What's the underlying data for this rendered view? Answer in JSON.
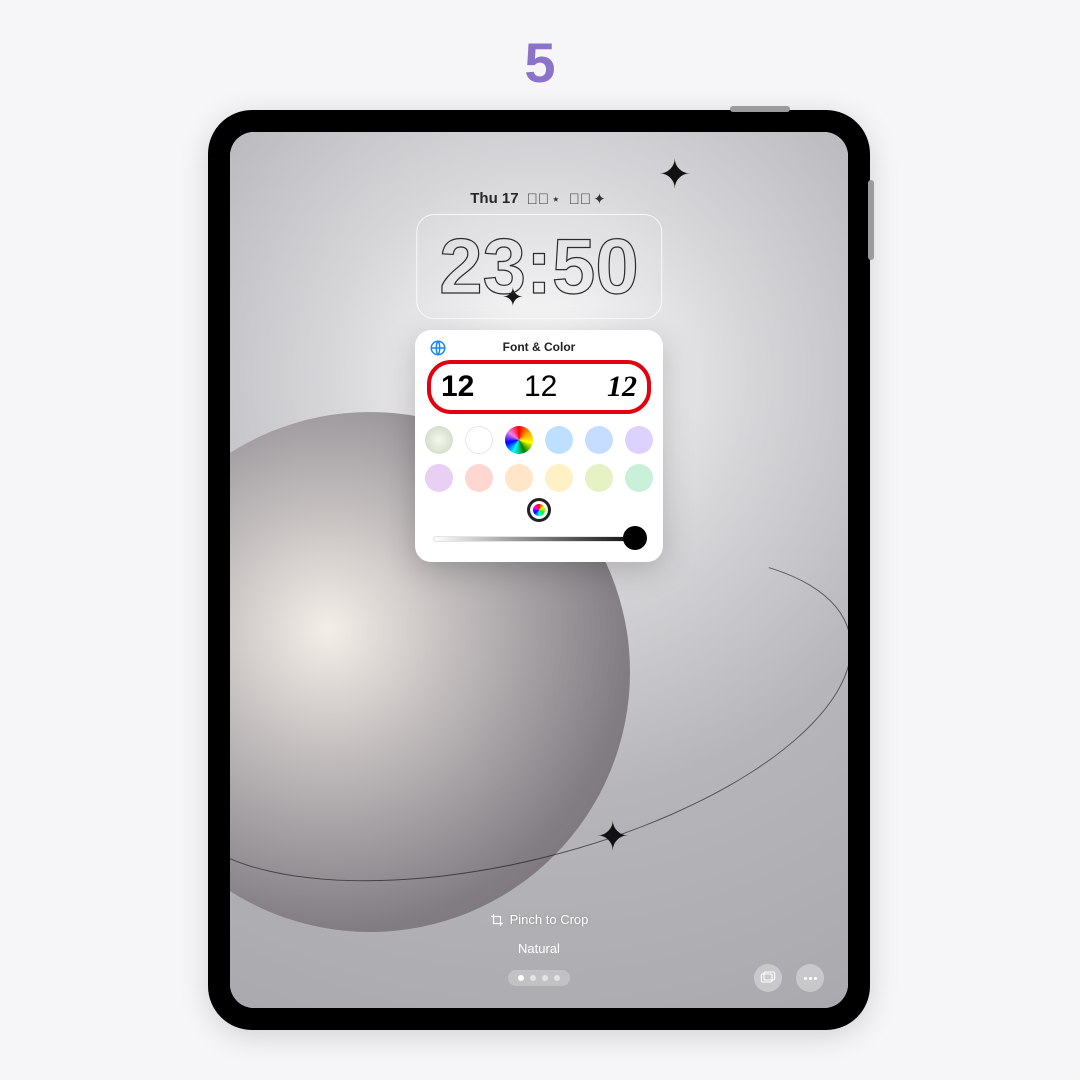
{
  "step_number": "5",
  "lockscreen": {
    "date_label": "Thu 17",
    "date_decoration": "✦༘⋆ ⋆༘✦",
    "clock_time": "23:50",
    "hint_text": "Pinch to Crop",
    "style_label": "Natural"
  },
  "popover": {
    "title": "Font & Color",
    "font_options": [
      "12",
      "12",
      "12"
    ],
    "colors_row1": [
      "#dfe4db",
      "#ffffff",
      "rainbow",
      "#bde0ff",
      "#c7ddff",
      "#dcd1ff"
    ],
    "colors_row2": [
      "#e9cff3",
      "#ffd6d0",
      "#ffe6c8",
      "#fff1c6",
      "#e6f2c4",
      "#c9f0d8"
    ]
  },
  "highlight_color": "#e3000f",
  "accent_color": "#8a73c9"
}
